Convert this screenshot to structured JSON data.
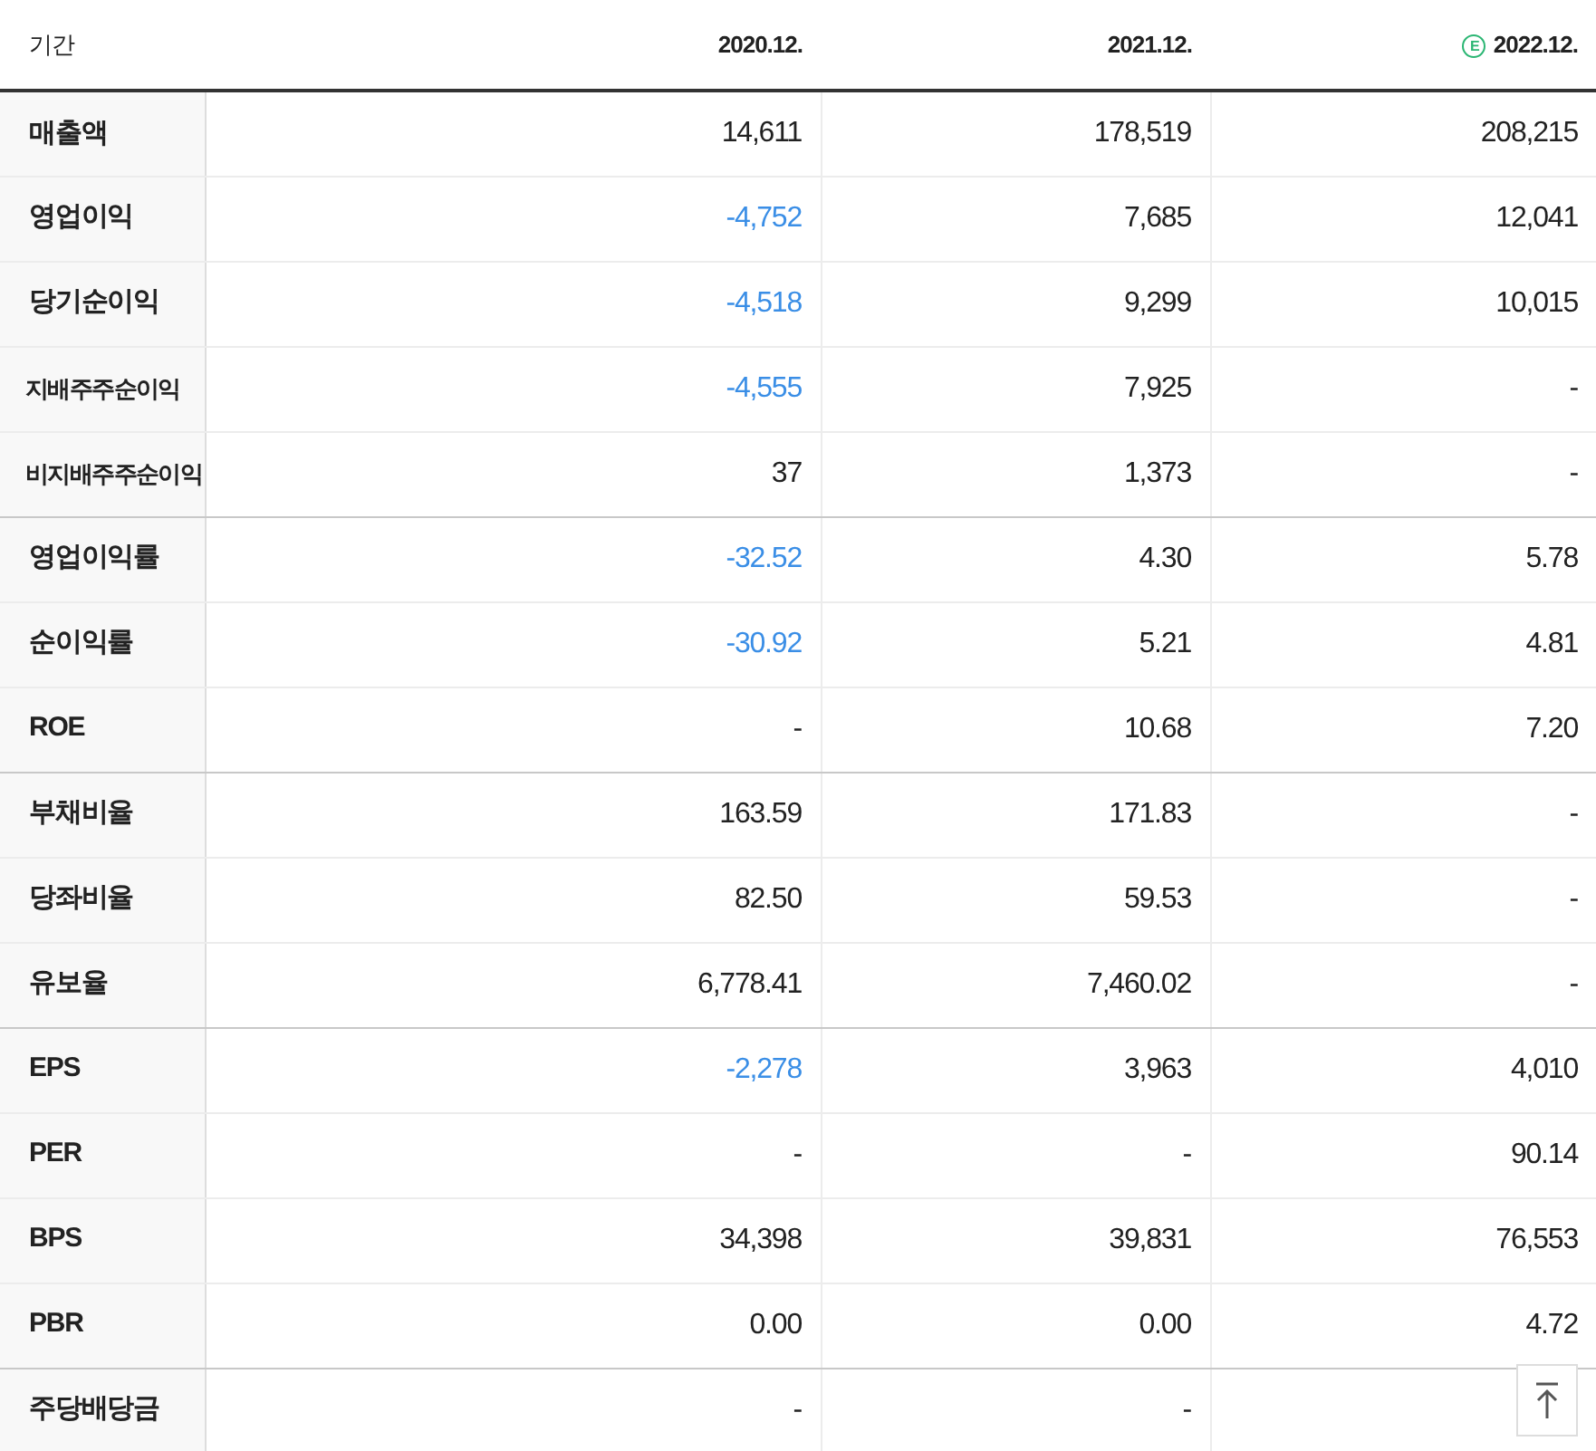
{
  "table": {
    "columns": [
      {
        "label": "기간"
      },
      {
        "label": "2020.12."
      },
      {
        "label": "2021.12."
      },
      {
        "label": "2022.12.",
        "badge": "E"
      }
    ],
    "groups": [
      {
        "rows": [
          {
            "label": "매출액",
            "kind": "main",
            "cells": [
              {
                "text": "14,611",
                "negative": false
              },
              {
                "text": "178,519",
                "negative": false
              },
              {
                "text": "208,215",
                "negative": false
              }
            ]
          },
          {
            "label": "영업이익",
            "kind": "main",
            "cells": [
              {
                "text": "-4,752",
                "negative": true
              },
              {
                "text": "7,685",
                "negative": false
              },
              {
                "text": "12,041",
                "negative": false
              }
            ]
          },
          {
            "label": "당기순이익",
            "kind": "main",
            "cells": [
              {
                "text": "-4,518",
                "negative": true
              },
              {
                "text": "9,299",
                "negative": false
              },
              {
                "text": "10,015",
                "negative": false
              }
            ]
          },
          {
            "label": "지배주주순이익",
            "kind": "sub",
            "cells": [
              {
                "text": "-4,555",
                "negative": true
              },
              {
                "text": "7,925",
                "negative": false
              },
              {
                "text": "-",
                "negative": false
              }
            ]
          },
          {
            "label": "비지배주주순이익",
            "kind": "sub",
            "cells": [
              {
                "text": "37",
                "negative": false
              },
              {
                "text": "1,373",
                "negative": false
              },
              {
                "text": "-",
                "negative": false
              }
            ]
          }
        ]
      },
      {
        "rows": [
          {
            "label": "영업이익률",
            "kind": "main",
            "cells": [
              {
                "text": "-32.52",
                "negative": true
              },
              {
                "text": "4.30",
                "negative": false
              },
              {
                "text": "5.78",
                "negative": false
              }
            ]
          },
          {
            "label": "순이익률",
            "kind": "main",
            "cells": [
              {
                "text": "-30.92",
                "negative": true
              },
              {
                "text": "5.21",
                "negative": false
              },
              {
                "text": "4.81",
                "negative": false
              }
            ]
          },
          {
            "label": "ROE",
            "kind": "main",
            "cells": [
              {
                "text": "-",
                "negative": false
              },
              {
                "text": "10.68",
                "negative": false
              },
              {
                "text": "7.20",
                "negative": false
              }
            ]
          }
        ]
      },
      {
        "rows": [
          {
            "label": "부채비율",
            "kind": "main",
            "cells": [
              {
                "text": "163.59",
                "negative": false
              },
              {
                "text": "171.83",
                "negative": false
              },
              {
                "text": "-",
                "negative": false
              }
            ]
          },
          {
            "label": "당좌비율",
            "kind": "main",
            "cells": [
              {
                "text": "82.50",
                "negative": false
              },
              {
                "text": "59.53",
                "negative": false
              },
              {
                "text": "-",
                "negative": false
              }
            ]
          },
          {
            "label": "유보율",
            "kind": "main",
            "cells": [
              {
                "text": "6,778.41",
                "negative": false
              },
              {
                "text": "7,460.02",
                "negative": false
              },
              {
                "text": "-",
                "negative": false
              }
            ]
          }
        ]
      },
      {
        "rows": [
          {
            "label": "EPS",
            "kind": "main",
            "cells": [
              {
                "text": "-2,278",
                "negative": true
              },
              {
                "text": "3,963",
                "negative": false
              },
              {
                "text": "4,010",
                "negative": false
              }
            ]
          },
          {
            "label": "PER",
            "kind": "main",
            "cells": [
              {
                "text": "-",
                "negative": false
              },
              {
                "text": "-",
                "negative": false
              },
              {
                "text": "90.14",
                "negative": false
              }
            ]
          },
          {
            "label": "BPS",
            "kind": "main",
            "cells": [
              {
                "text": "34,398",
                "negative": false
              },
              {
                "text": "39,831",
                "negative": false
              },
              {
                "text": "76,553",
                "negative": false
              }
            ]
          },
          {
            "label": "PBR",
            "kind": "main",
            "cells": [
              {
                "text": "0.00",
                "negative": false
              },
              {
                "text": "0.00",
                "negative": false
              },
              {
                "text": "4.72",
                "negative": false
              }
            ]
          }
        ]
      },
      {
        "rows": [
          {
            "label": "주당배당금",
            "kind": "main",
            "cells": [
              {
                "text": "-",
                "negative": false
              },
              {
                "text": "-",
                "negative": false
              }
            ]
          }
        ]
      }
    ]
  }
}
